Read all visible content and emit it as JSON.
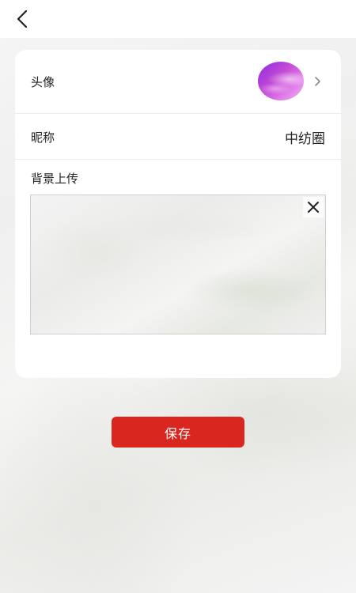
{
  "header": {
    "back_icon": "chevron-left-icon"
  },
  "profile": {
    "avatar_label": "头像",
    "avatar_chevron_icon": "chevron-right-icon",
    "nickname_label": "昵称",
    "nickname_value": "中纺圈",
    "background_label": "背景上传",
    "remove_icon": "close-icon"
  },
  "actions": {
    "save_label": "保存"
  },
  "colors": {
    "save_button": "#d9261f",
    "card": "#ffffff",
    "text": "#222222"
  }
}
